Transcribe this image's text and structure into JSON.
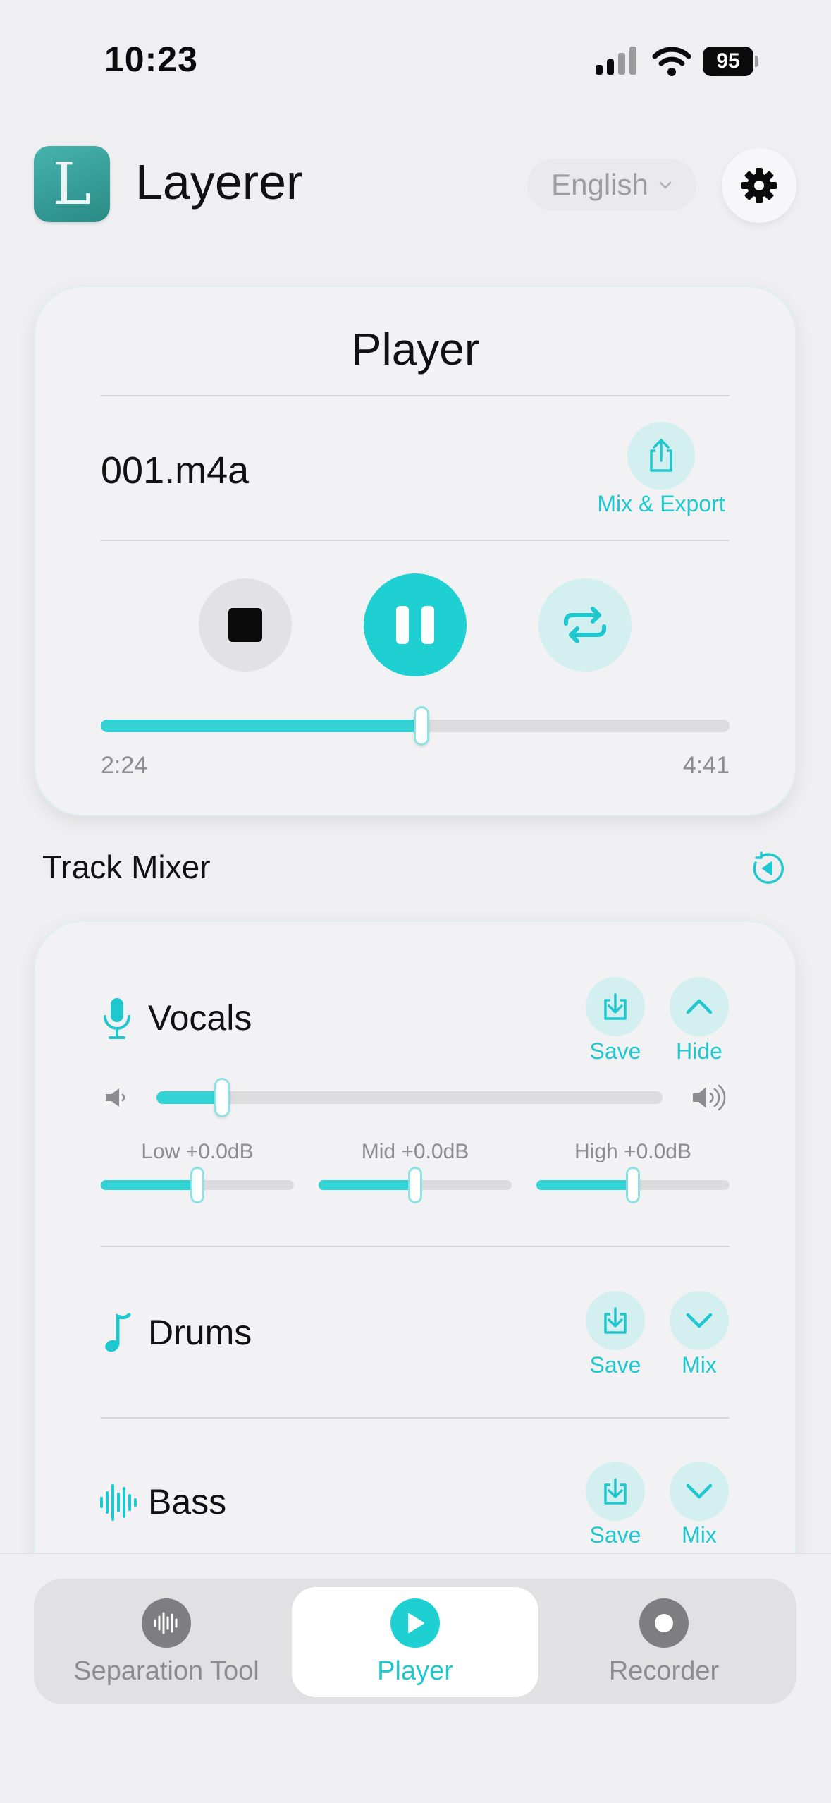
{
  "status_bar": {
    "time": "10:23",
    "battery": "95"
  },
  "header": {
    "app_name": "Layerer",
    "logo_letter": "L",
    "language": "English"
  },
  "player": {
    "title": "Player",
    "file_name": "001.m4a",
    "export_label": "Mix & Export",
    "progress": 0.51,
    "elapsed": "2:24",
    "duration": "4:41"
  },
  "mixer": {
    "section_title": "Track Mixer",
    "tracks": [
      {
        "name": "Vocals",
        "icon": "microphone-icon",
        "save_label": "Save",
        "toggle_label": "Hide",
        "volume": 0.13,
        "eq": [
          {
            "label": "Low +0.0dB",
            "value": 0.5
          },
          {
            "label": "Mid +0.0dB",
            "value": 0.5
          },
          {
            "label": "High +0.0dB",
            "value": 0.5
          }
        ]
      },
      {
        "name": "Drums",
        "icon": "music-note-icon",
        "save_label": "Save",
        "toggle_label": "Mix"
      },
      {
        "name": "Bass",
        "icon": "waveform-icon",
        "save_label": "Save",
        "toggle_label": "Mix"
      }
    ]
  },
  "tab_bar": {
    "tabs": [
      {
        "label": "Separation Tool",
        "icon": "waveform-icon",
        "active": false
      },
      {
        "label": "Player",
        "icon": "play-icon",
        "active": true
      },
      {
        "label": "Recorder",
        "icon": "record-icon",
        "active": false
      }
    ]
  },
  "colors": {
    "accent": "#1fd0d2",
    "accent_soft": "#d4eff0",
    "background": "#efeff2",
    "text": "#111111",
    "muted": "#8c8c92"
  }
}
